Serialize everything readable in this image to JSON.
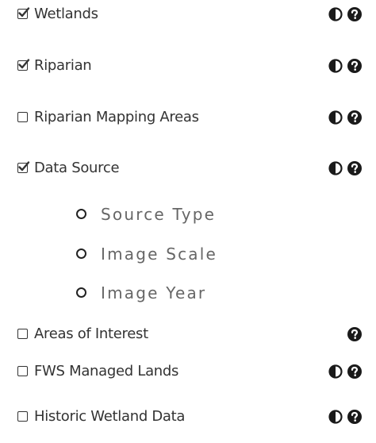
{
  "layers": [
    {
      "label": "Wetlands",
      "checked": true,
      "has_opacity": true,
      "has_help": true
    },
    {
      "label": "Riparian",
      "checked": true,
      "has_opacity": true,
      "has_help": true
    },
    {
      "label": "Riparian Mapping Areas",
      "checked": false,
      "has_opacity": true,
      "has_help": true
    },
    {
      "label": "Data Source",
      "checked": true,
      "has_opacity": true,
      "has_help": true
    },
    {
      "label": "Areas of Interest",
      "checked": false,
      "has_opacity": false,
      "has_help": true
    },
    {
      "label": "FWS Managed Lands",
      "checked": false,
      "has_opacity": true,
      "has_help": true
    },
    {
      "label": "Historic Wetland Data",
      "checked": false,
      "has_opacity": true,
      "has_help": true
    }
  ],
  "data_source_options": [
    {
      "label": "Source Type",
      "selected": false
    },
    {
      "label": "Image Scale",
      "selected": false
    },
    {
      "label": "Image Year",
      "selected": false
    }
  ],
  "icons": {
    "checkbox_checked": "check-square-o-icon",
    "checkbox_unchecked": "square-o-icon",
    "opacity": "adjust-icon",
    "help": "question-circle-icon",
    "radio": "circle-o-icon"
  },
  "colors": {
    "text": "#333333",
    "sub_text": "#666666",
    "icon": "#1a1a1a"
  }
}
